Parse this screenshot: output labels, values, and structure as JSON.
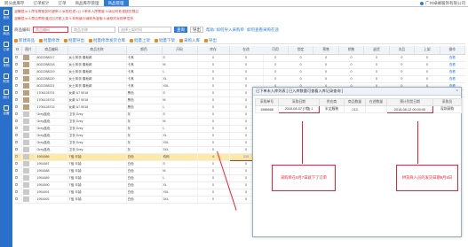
{
  "topnav": {
    "tabs": [
      "跨分类库存",
      "订单统计",
      "订单",
      "商品库存管理",
      "商品管理"
    ],
    "active_index": 4,
    "right_text": "广州卓峰服饰有限公司"
  },
  "sidebar": {
    "items": [
      "首页",
      "商品",
      "订单",
      "采购",
      "财务",
      "统计",
      "设置"
    ]
  },
  "notices": [
    "温馨提示:1.库存数据实时更新 2.采购在途=已下单未入库数量 3.请及时处理缺货商品",
    "温馨提示:4.商品审核通过后才能上架 5.如有疑问请联系客服 6.请核对采购单信息"
  ],
  "filters": {
    "code_label": "商品编码",
    "code_placeholder": "商品编码",
    "keyword_placeholder": "商品名称",
    "date_placeholder": "选择上架时间",
    "search_label": "查询",
    "export_label": "导出",
    "help_links": [
      "帮助: 如何导入采购单",
      "如何查看采购在途"
    ]
  },
  "toolbar": {
    "items": [
      "新建商品",
      "批量修改",
      "批量导出",
      "批量修改发货仓库",
      "批量上架",
      "批量下架",
      "采购入库",
      "导出"
    ]
  },
  "table": {
    "headers": [
      "",
      "图片",
      "商品编码",
      "商品名称",
      "颜色",
      "尺码",
      "库存",
      "在途"
    ],
    "rows": [
      {
        "code": "8022288217",
        "name": "女士风衣 春秋款",
        "color": "卡其",
        "size": "S",
        "stock": "0",
        "transit": "0",
        "thumb": "b",
        "hl": false
      },
      {
        "code": "8022288218",
        "name": "女士风衣 春秋款",
        "color": "卡其",
        "size": "M",
        "stock": "0",
        "transit": "0",
        "thumb": "b",
        "hl": false
      },
      {
        "code": "8022288219",
        "name": "女士风衣 春秋款",
        "color": "卡其",
        "size": "L",
        "stock": "0",
        "transit": "0",
        "thumb": "b",
        "hl": false
      },
      {
        "code": "8022288220",
        "name": "女士风衣 春秋款",
        "color": "卡其",
        "size": "XL",
        "stock": "0",
        "transit": "0",
        "thumb": "b",
        "hl": false
      },
      {
        "code": "8022288221",
        "name": "女士风衣 春秋款",
        "color": "卡其",
        "size": "XXL",
        "stock": "0",
        "transit": "0",
        "thumb": "b",
        "hl": false
      },
      {
        "code": "1706128701",
        "name": "女款 A7 5018",
        "color": "黑色",
        "size": "S",
        "stock": "0",
        "transit": "0",
        "thumb": "b",
        "hl": false
      },
      {
        "code": "1706128702",
        "name": "女款 A7 5018",
        "color": "黑色",
        "size": "M",
        "stock": "0",
        "transit": "0",
        "thumb": "b",
        "hl": false
      },
      {
        "code": "1706128703",
        "name": "女款 A7 5018",
        "color": "黑色",
        "size": "L",
        "stock": "0",
        "transit": "0",
        "thumb": "b",
        "hl": false
      },
      {
        "code": "Grey蓝色",
        "name": "卫衣 Grey",
        "color": "灰",
        "size": "S",
        "stock": "0",
        "transit": "0",
        "thumb": "g",
        "hl": false
      },
      {
        "code": "Grey蓝色",
        "name": "卫衣 Grey",
        "color": "灰",
        "size": "M",
        "stock": "0",
        "transit": "0",
        "thumb": "g",
        "hl": false
      },
      {
        "code": "Grey蓝色",
        "name": "卫衣 Grey",
        "color": "灰",
        "size": "L",
        "stock": "0",
        "transit": "0",
        "thumb": "g",
        "hl": false
      },
      {
        "code": "Grey蓝色",
        "name": "卫衣 Grey",
        "color": "灰",
        "size": "XL",
        "stock": "0",
        "transit": "0",
        "thumb": "g",
        "hl": false
      },
      {
        "code": "Grey蓝色",
        "name": "卫衣 Grey",
        "color": "灰",
        "size": "XXL",
        "stock": "0",
        "transit": "0",
        "thumb": "g",
        "hl": false
      },
      {
        "code": "Grey蓝色",
        "name": "卫衣 Grey",
        "color": "灰",
        "size": "3XL",
        "stock": "0",
        "transit": "0",
        "thumb": "g",
        "hl": false
      },
      {
        "code": "1951686",
        "name": "T恤 半袖",
        "color": "白色",
        "size": "均码",
        "stock": "4",
        "transit": "213",
        "thumb": "g",
        "hl": true
      },
      {
        "code": "1951687",
        "name": "T恤 半袖",
        "color": "白色",
        "size": "S",
        "stock": "0",
        "transit": "0",
        "thumb": "g",
        "hl": false
      },
      {
        "code": "1951688",
        "name": "T恤 半袖",
        "color": "白色",
        "size": "M",
        "stock": "0",
        "transit": "0",
        "thumb": "g",
        "hl": false
      },
      {
        "code": "1951689",
        "name": "T恤 半袖",
        "color": "白色",
        "size": "L",
        "stock": "0",
        "transit": "0",
        "thumb": "g",
        "hl": false
      },
      {
        "code": "1951690",
        "name": "T恤 半袖",
        "color": "白色",
        "size": "XL",
        "stock": "0",
        "transit": "0",
        "thumb": "g",
        "hl": false
      },
      {
        "code": "1951691",
        "name": "T恤 半袖",
        "color": "白色",
        "size": "XXL",
        "stock": "0",
        "transit": "0",
        "thumb": "g",
        "hl": false
      },
      {
        "code": "1951692",
        "name": "T恤 半袖",
        "color": "白色",
        "size": "3XL",
        "stock": "0",
        "transit": "0",
        "thumb": "g",
        "hl": false
      }
    ]
  },
  "rtable": {
    "headers": [
      "可用",
      "锁定",
      "预售",
      "销售",
      "退货",
      "次品",
      "上架",
      "操作"
    ],
    "rows": [
      [
        "0",
        "0",
        "0",
        "0",
        "0",
        "0",
        "0",
        "查看"
      ],
      [
        "0",
        "0",
        "0",
        "0",
        "0",
        "0",
        "0",
        "查看"
      ],
      [
        "0",
        "0",
        "0",
        "0",
        "0",
        "0",
        "0",
        "查看"
      ],
      [
        "0",
        "0",
        "0",
        "0",
        "0",
        "0",
        "0",
        "查看"
      ],
      [
        "0",
        "0",
        "0",
        "0",
        "0",
        "0",
        "0",
        "查看"
      ],
      [
        "0",
        "0",
        "0",
        "0",
        "0",
        "0",
        "0",
        "查看"
      ]
    ]
  },
  "popup": {
    "title": "已下单未入库列表 [ 已入库数量可查看入库记录查询 ]",
    "headers": [
      "采购单号",
      "采购日期",
      "供应商",
      "商品数量",
      "在途数量",
      "预计到货日期",
      "采购员"
    ],
    "row": [
      "1986666",
      "2018-08-07 [T恤] 1",
      "半丈服装",
      "213",
      "",
      "2018-08-12 00:00:00",
      "深圳采购"
    ],
    "close_label": "×"
  },
  "callouts": {
    "left": "采购单在8月7日就下了订单",
    "right": "供货商人员的发货日期9月8日"
  }
}
